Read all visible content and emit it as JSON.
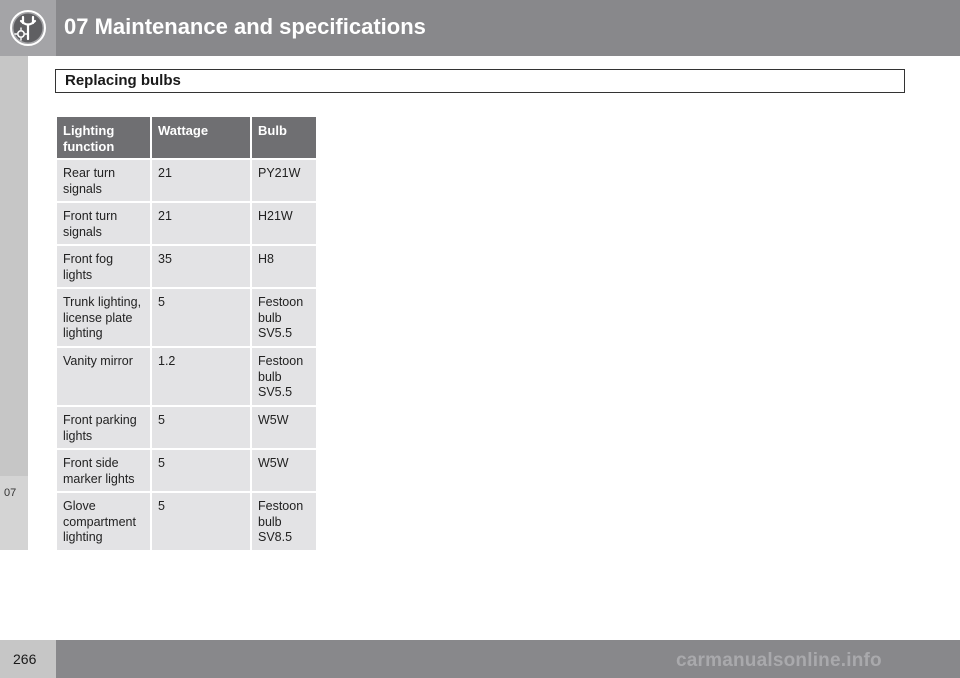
{
  "header": {
    "chapter_title": "07 Maintenance and specifications",
    "icon": "wrench-gear-icon"
  },
  "section": {
    "title": "Replacing bulbs"
  },
  "side_tab": {
    "label": "07"
  },
  "table": {
    "columns": [
      "Lighting function",
      "Wattage",
      "Bulb"
    ],
    "rows": [
      {
        "function": "Rear turn signals",
        "wattage": "21",
        "bulb": "PY21W"
      },
      {
        "function": "Front turn signals",
        "wattage": "21",
        "bulb": "H21W"
      },
      {
        "function": "Front fog lights",
        "wattage": "35",
        "bulb": "H8"
      },
      {
        "function": "Trunk lighting, license plate lighting",
        "wattage": "5",
        "bulb": "Festoon bulb SV5.5"
      },
      {
        "function": "Vanity mirror",
        "wattage": "1.2",
        "bulb": "Festoon bulb SV5.5"
      },
      {
        "function": "Front parking lights",
        "wattage": "5",
        "bulb": "W5W"
      },
      {
        "function": "Front side marker lights",
        "wattage": "5",
        "bulb": "W5W"
      },
      {
        "function": "Glove compartment lighting",
        "wattage": "5",
        "bulb": "Festoon bulb SV8.5"
      }
    ]
  },
  "footer": {
    "page_number": "266",
    "watermark": "carmanualsonline.info"
  }
}
